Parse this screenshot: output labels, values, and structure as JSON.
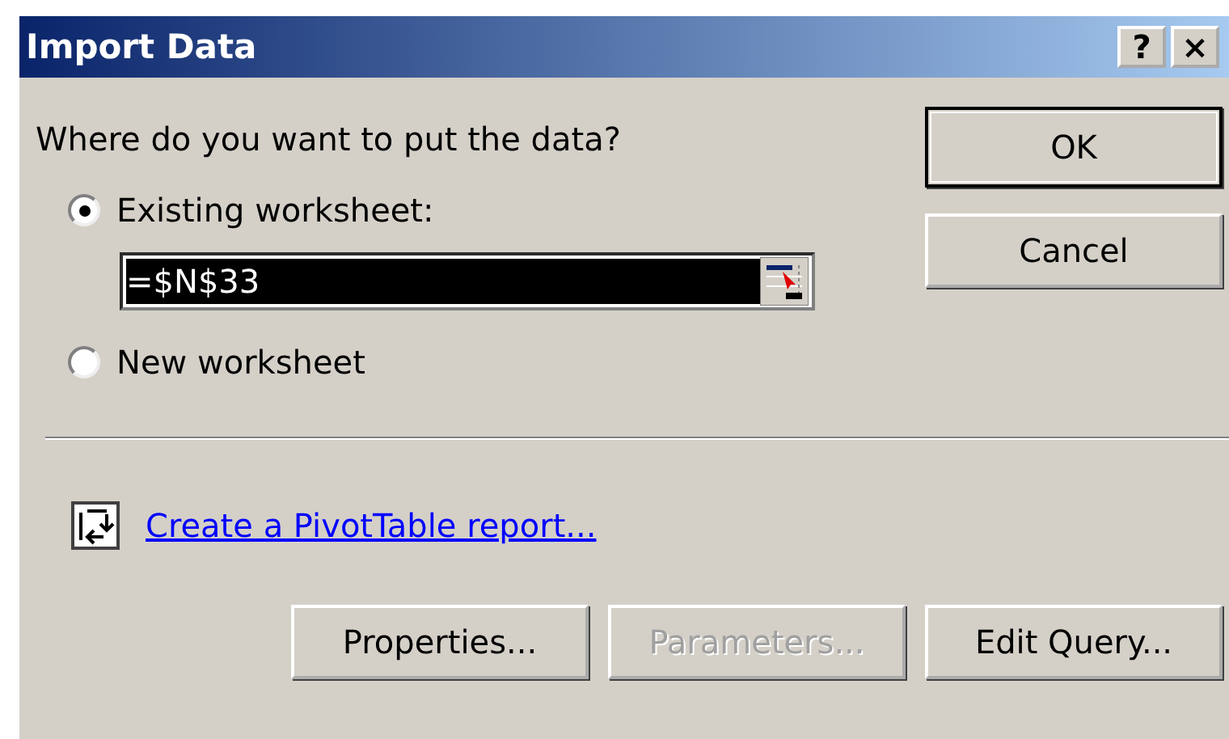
{
  "window": {
    "title": "Import Data",
    "title_buttons": [
      {
        "label": "?"
      },
      {
        "label": "×"
      }
    ]
  },
  "question": "Where do you want to put the data?",
  "options": [
    {
      "label": "Existing worksheet:",
      "selected": true
    },
    {
      "label": "New worksheet",
      "selected": false
    }
  ],
  "range_field": {
    "value": "=$N$33",
    "highlighted": true
  },
  "pivot_link": "Create a PivotTable report...",
  "side_buttons": [
    {
      "label": "OK",
      "default": true,
      "disabled": false
    },
    {
      "label": "Cancel",
      "default": false,
      "disabled": false
    }
  ],
  "bottom_buttons": [
    {
      "label": "Properties...",
      "disabled": false
    },
    {
      "label": "Parameters...",
      "disabled": true
    },
    {
      "label": "Edit Query...",
      "disabled": false
    }
  ]
}
